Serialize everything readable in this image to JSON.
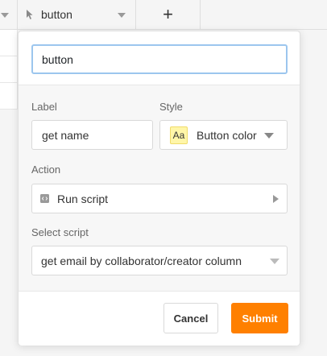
{
  "table": {
    "column_name": "button",
    "add_column_label": "+"
  },
  "editor": {
    "name_value": "button",
    "label_caption": "Label",
    "label_value": "get name",
    "style_caption": "Style",
    "style_swatch": "Aa",
    "style_value": "Button color",
    "action_caption": "Action",
    "action_value": "Run script",
    "select_script_caption": "Select script",
    "select_script_value": "get email by collaborator/creator column"
  },
  "footer": {
    "cancel_label": "Cancel",
    "submit_label": "Submit"
  },
  "colors": {
    "submit": "#ff8000",
    "input_focus": "#9cc6ee",
    "style_swatch": "#fff6a8"
  }
}
